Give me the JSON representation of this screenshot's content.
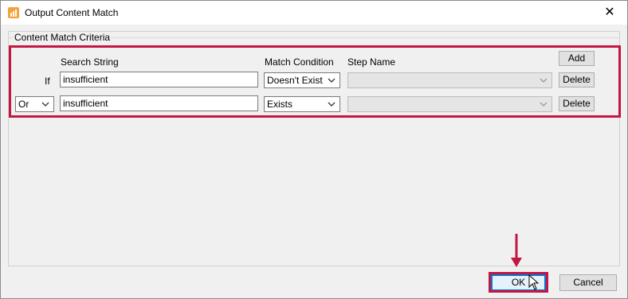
{
  "window": {
    "title": "Output Content Match",
    "close_glyph": "✕"
  },
  "group": {
    "label": "Content Match Criteria"
  },
  "headers": {
    "search_string": "Search String",
    "match_condition": "Match Condition",
    "step_name": "Step Name"
  },
  "buttons": {
    "add": "Add",
    "delete": "Delete",
    "ok": "OK",
    "cancel": "Cancel"
  },
  "rows": [
    {
      "logic_label": "If",
      "search_value": "insufficient",
      "match_condition": "Doesn't Exist",
      "step_name": ""
    },
    {
      "logic_select": "Or",
      "search_value": "insufficient",
      "match_condition": "Exists",
      "step_name": ""
    }
  ],
  "colors": {
    "highlight": "#c41740",
    "ok_focus": "#0078d7",
    "app_icon": "#f2a23a"
  },
  "icons": {
    "app": "chart-bars-icon",
    "close": "close-icon",
    "dropdown": "chevron-down-icon",
    "pointer": "mouse-pointer-icon",
    "annotation": "down-arrow-icon"
  }
}
